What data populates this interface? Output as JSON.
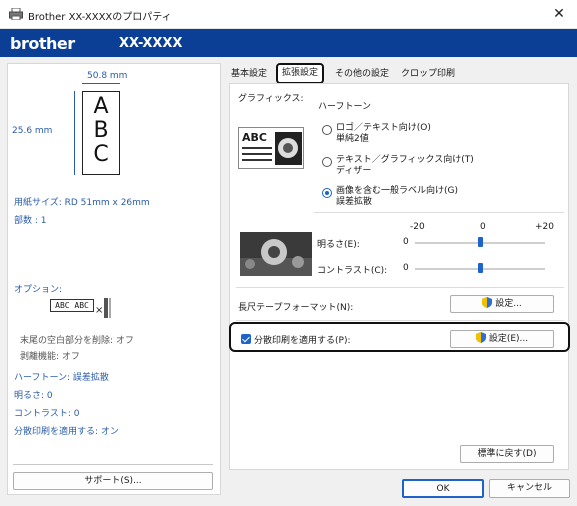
{
  "window": {
    "title": "Brother XX-XXXXのプロパティ",
    "close_glyph": "✕"
  },
  "brand": {
    "logo": "brother",
    "model": "XX-XXXX"
  },
  "preview": {
    "width_label": "50.8 mm",
    "height_label": "25.6 mm",
    "letters": [
      "A",
      "B",
      "C"
    ]
  },
  "left_info": {
    "paper_size": "用紙サイズ: RD 51mm x 26mm",
    "copies": "部数 : 1",
    "options_label": "オプション:",
    "tape_sample": "ABC ABC",
    "blank_delete": "末尾の空白部分を削除: オフ",
    "peel": "剥離機能: オフ",
    "halftone": "ハーフトーン: 誤差拡散",
    "brightness": "明るさ:   0",
    "contrast": "コントラスト:   0",
    "split_print": "分散印刷を適用する: オン",
    "support_button": "サポート(S)..."
  },
  "tabs": [
    {
      "label": "基本設定",
      "active": false
    },
    {
      "label": "拡張設定",
      "active": true
    },
    {
      "label": "その他の設定",
      "active": false
    },
    {
      "label": "クロップ印刷",
      "active": false
    }
  ],
  "graphics": {
    "label": "グラフィックス:",
    "halftone_label": "ハーフトーン",
    "icon_text": "ABC",
    "options": [
      {
        "line1": "ロゴ／テキスト向け(O)",
        "line2": "単純2値",
        "selected": false
      },
      {
        "line1": "テキスト／グラフィックス向け(T)",
        "line2": "ディザー",
        "selected": false
      },
      {
        "line1": "画像を含む一般ラベル向け(G)",
        "line2": "誤差拡散",
        "selected": true
      }
    ]
  },
  "adjust": {
    "scale_min": "-20",
    "scale_mid": "0",
    "scale_max": "+20",
    "brightness_label": "明るさ(E):",
    "brightness_value": "0",
    "brightness_level": 0.5,
    "contrast_label": "コントラスト(C):",
    "contrast_value": "0",
    "contrast_level": 0.5
  },
  "long_tape": {
    "label": "長尺テープフォーマット(N):",
    "button": "設定..."
  },
  "split": {
    "label": "分散印刷を適用する(P):",
    "checked": true,
    "button": "設定(E)..."
  },
  "restore_button": "標準に戻す(D)",
  "ok_button": "OK",
  "cancel_button": "キャンセル"
}
